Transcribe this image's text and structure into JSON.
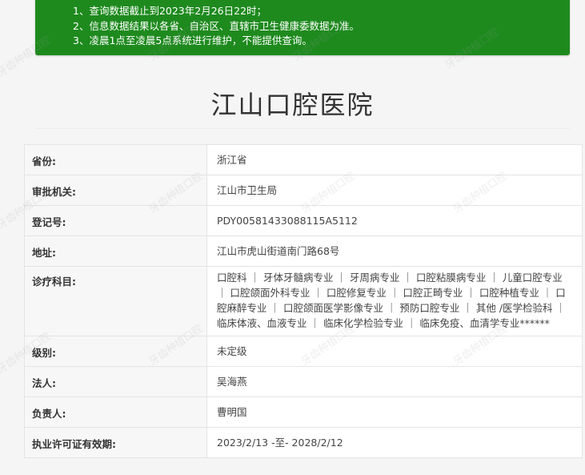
{
  "notice": {
    "lines": [
      "1、查询数据截止到2023年2月26日22时；",
      "2、信息数据结果以各省、自治区、直辖市卫生健康委数据为准。",
      "3、凌晨1点至凌晨5点系统进行维护，不能提供查询。"
    ],
    "background": "#1e8a1e"
  },
  "hospital": {
    "name": "江山口腔医院"
  },
  "fields": {
    "province": {
      "label": "省份:",
      "value": "浙江省"
    },
    "authority": {
      "label": "审批机关:",
      "value": "江山市卫生局"
    },
    "reg_no": {
      "label": "登记号:",
      "value": "PDY00581433088115A5112"
    },
    "address": {
      "label": "地址:",
      "value": "江山市虎山街道南门路68号"
    },
    "subjects": {
      "label": "诊疗科目:",
      "value": "口腔科 ｜ 牙体牙髓病专业 ｜ 牙周病专业 ｜ 口腔粘膜病专业 ｜ 儿童口腔专业 ｜ 口腔颌面外科专业 ｜ 口腔修复专业 ｜ 口腔正畸专业 ｜ 口腔种植专业 ｜ 口腔麻醉专业 ｜ 口腔颌面医学影像专业 ｜ 预防口腔专业 ｜ 其他 /医学检验科 ｜ 临床体液、血液专业 ｜ 临床化学检验专业 ｜ 临床免疫、血清学专业******"
    },
    "level": {
      "label": "级别:",
      "value": "未定级"
    },
    "legal_person": {
      "label": "法人:",
      "value": "吴海燕"
    },
    "principal": {
      "label": "负责人:",
      "value": "曹明国"
    },
    "license_validity": {
      "label": "执业许可证有效期:",
      "value": "2023/2/13 -至- 2028/2/12"
    }
  },
  "watermark": {
    "text": "牙齿种植口腔 yakete.com"
  }
}
